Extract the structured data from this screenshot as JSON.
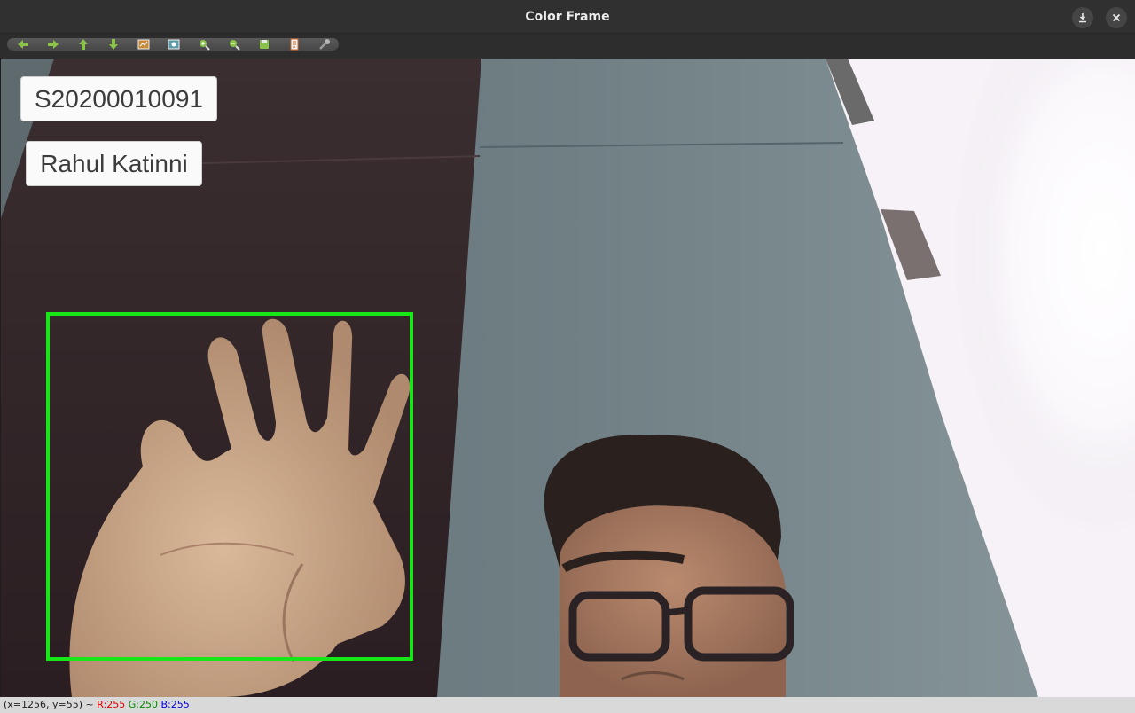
{
  "window": {
    "title": "Color Frame",
    "download_icon": "download-icon",
    "close_icon": "close-icon"
  },
  "toolbar": {
    "tools": [
      "pan-left-icon",
      "pan-right-icon",
      "pan-up-icon",
      "pan-down-icon",
      "zoom-fit-icon",
      "zoom-original-icon",
      "zoom-in-icon",
      "zoom-out-icon",
      "save-icon",
      "properties-icon",
      "settings-icon"
    ]
  },
  "overlay": {
    "student_id": "S20200010091",
    "student_name": "Rahul Katinni",
    "box_color": "#17e617"
  },
  "status": {
    "coords": "(x=1256, y=55) ~",
    "r": "R:255",
    "g": "G:250",
    "b": "B:255"
  }
}
